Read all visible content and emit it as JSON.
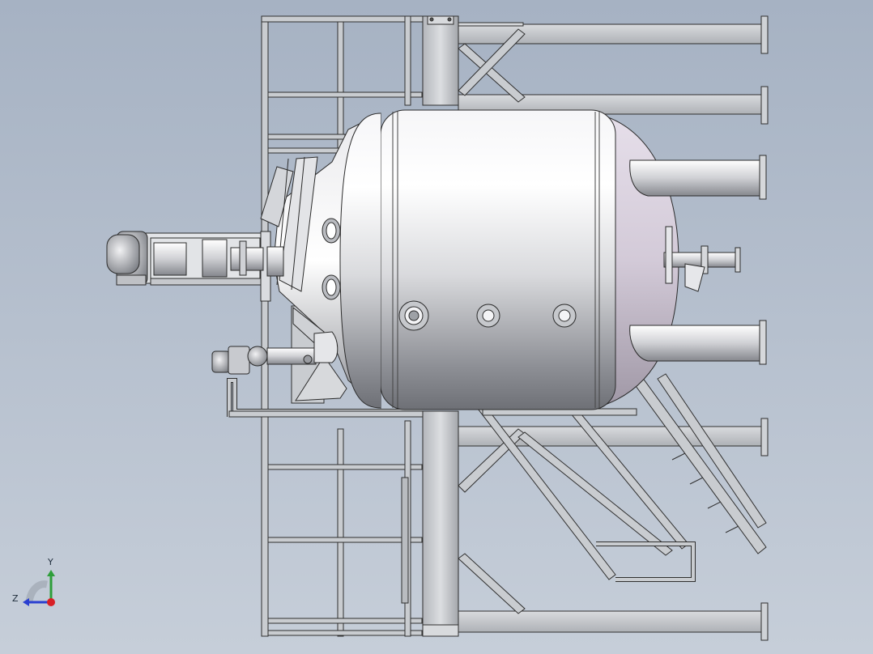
{
  "viewport": {
    "background_top": "#a6b2c3",
    "background_bottom": "#c6ced9"
  },
  "model": {
    "components": [
      "frame-structure",
      "vessel-body",
      "agitator-drive",
      "discharge-pump",
      "inspection-flanges",
      "side-nozzles",
      "ladder"
    ],
    "colors": {
      "steel": "#c4c7cc",
      "steel_edge": "#2b2b2b",
      "vessel_highlight": "#ffffff",
      "vessel_shadow": "#8d8f96",
      "dish_tint": "#d7cfdc"
    }
  },
  "triad": {
    "y_label": "Y",
    "z_label": "Z",
    "y_color": "#2e9e3a",
    "z_color": "#2a3fd0",
    "x_color": "#d81f26"
  }
}
